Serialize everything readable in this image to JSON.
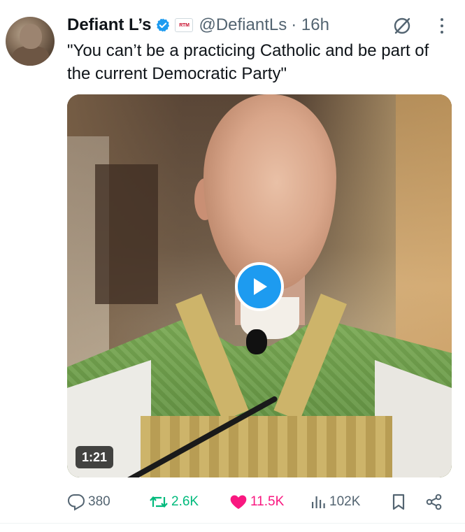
{
  "author": {
    "display_name": "Defiant L’s",
    "handle": "@DefiantLs",
    "time": "· 16h",
    "affiliate_badge": "RTM",
    "verified": true
  },
  "tweet": {
    "text": "\"You can’t be a practicing Catholic and be part of the current Democratic Party\""
  },
  "media": {
    "type": "video",
    "duration": "1:21"
  },
  "actions": {
    "replies": "380",
    "reposts": "2.6K",
    "likes": "11.5K",
    "views": "102K"
  },
  "colors": {
    "accent": "#1d9bf0",
    "repost": "#00ba7c",
    "like": "#f91880",
    "secondary_text": "#536471"
  },
  "icons": [
    "verified-badge-icon",
    "grok-icon",
    "more-icon",
    "play-icon",
    "reply-icon",
    "repost-icon",
    "like-icon",
    "views-icon",
    "bookmark-icon",
    "share-icon"
  ]
}
